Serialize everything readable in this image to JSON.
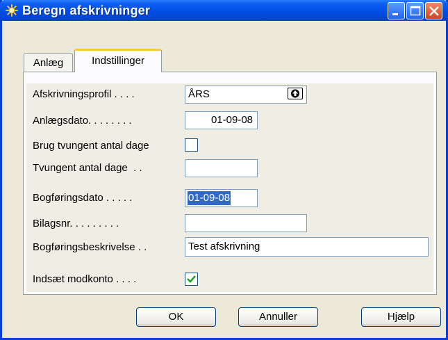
{
  "window": {
    "title": "Beregn afskrivninger",
    "controls": [
      "minimize-icon",
      "maximize-icon",
      "close-icon"
    ],
    "colors": {
      "titlebar": "#0050e6",
      "face": "#ece9d8",
      "active_tab_accent": "#ffc83c",
      "selection": "#316ac5"
    }
  },
  "tabs": [
    {
      "label": "Anlæg",
      "active": false
    },
    {
      "label": "Indstillinger",
      "active": true
    }
  ],
  "form": {
    "profile": {
      "label": "Afskrivningsprofil . . . .",
      "value": "ÅRS"
    },
    "asset_date": {
      "label": "Anlægsdato. . . . . . . .",
      "value": "01-09-08"
    },
    "forced_days_check": {
      "label": "Brug tvungent antal dage",
      "checked": false
    },
    "forced_days": {
      "label": "Tvungent antal dage  . .",
      "value": ""
    },
    "posting_date": {
      "label": "Bogføringsdato . . . . .",
      "value": "01-09-08"
    },
    "document_no": {
      "label": "Bilagsnr. . . . . . . . .",
      "value": ""
    },
    "posting_desc": {
      "label": "Bogføringsbeskrivelse . .",
      "value": "Test afskrivning"
    },
    "insert_balance": {
      "label": "Indsæt modkonto . . . .",
      "checked": true
    }
  },
  "buttons": {
    "ok": "OK",
    "cancel": "Annuller",
    "help": "Hjælp"
  }
}
